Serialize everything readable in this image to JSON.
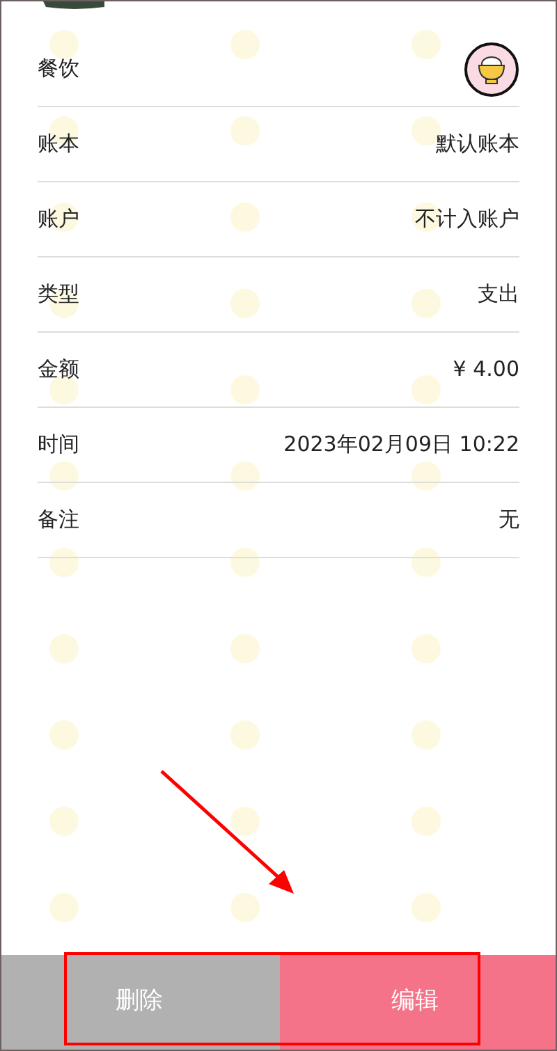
{
  "details": [
    {
      "kind": "icon",
      "label": "餐饮"
    },
    {
      "kind": "text",
      "label": "账本",
      "value": "默认账本"
    },
    {
      "kind": "text",
      "label": "账户",
      "value": "不计入账户"
    },
    {
      "kind": "text",
      "label": "类型",
      "value": "支出"
    },
    {
      "kind": "text",
      "label": "金额",
      "value": "¥ 4.00"
    },
    {
      "kind": "text",
      "label": "时间",
      "value": "2023年02月09日 10:22"
    },
    {
      "kind": "text",
      "label": "备注",
      "value": "无"
    }
  ],
  "actions": [
    {
      "kind": "delete",
      "label": "删除"
    },
    {
      "kind": "edit",
      "label": "编辑"
    }
  ],
  "annotation": {
    "arrow": true,
    "highlight": true
  }
}
